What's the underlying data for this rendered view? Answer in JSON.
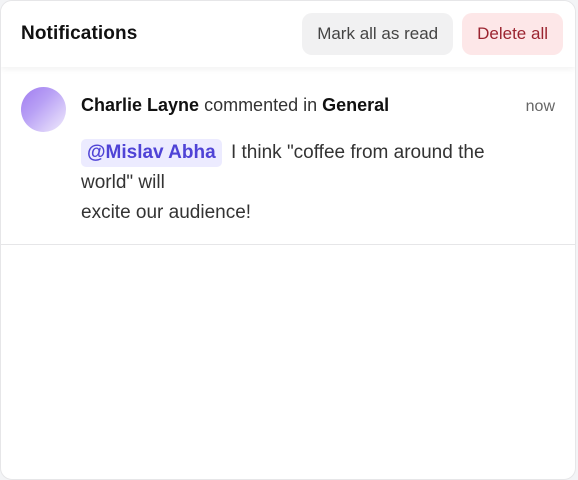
{
  "header": {
    "title": "Notifications",
    "mark_all_label": "Mark all as read",
    "delete_all_label": "Delete all"
  },
  "notifications": [
    {
      "author": "Charlie Layne",
      "action": "commented in",
      "channel": "General",
      "time": "now",
      "mention": "@Mislav Abha",
      "comment_text": "I think \"coffee from around the world\" will",
      "comment_text_2": "excite our audience!"
    }
  ],
  "colors": {
    "accent": "#4f43d6",
    "mention_bg": "#ecebff",
    "delete_bg": "#fde7e8",
    "delete_text": "#9b2430"
  }
}
